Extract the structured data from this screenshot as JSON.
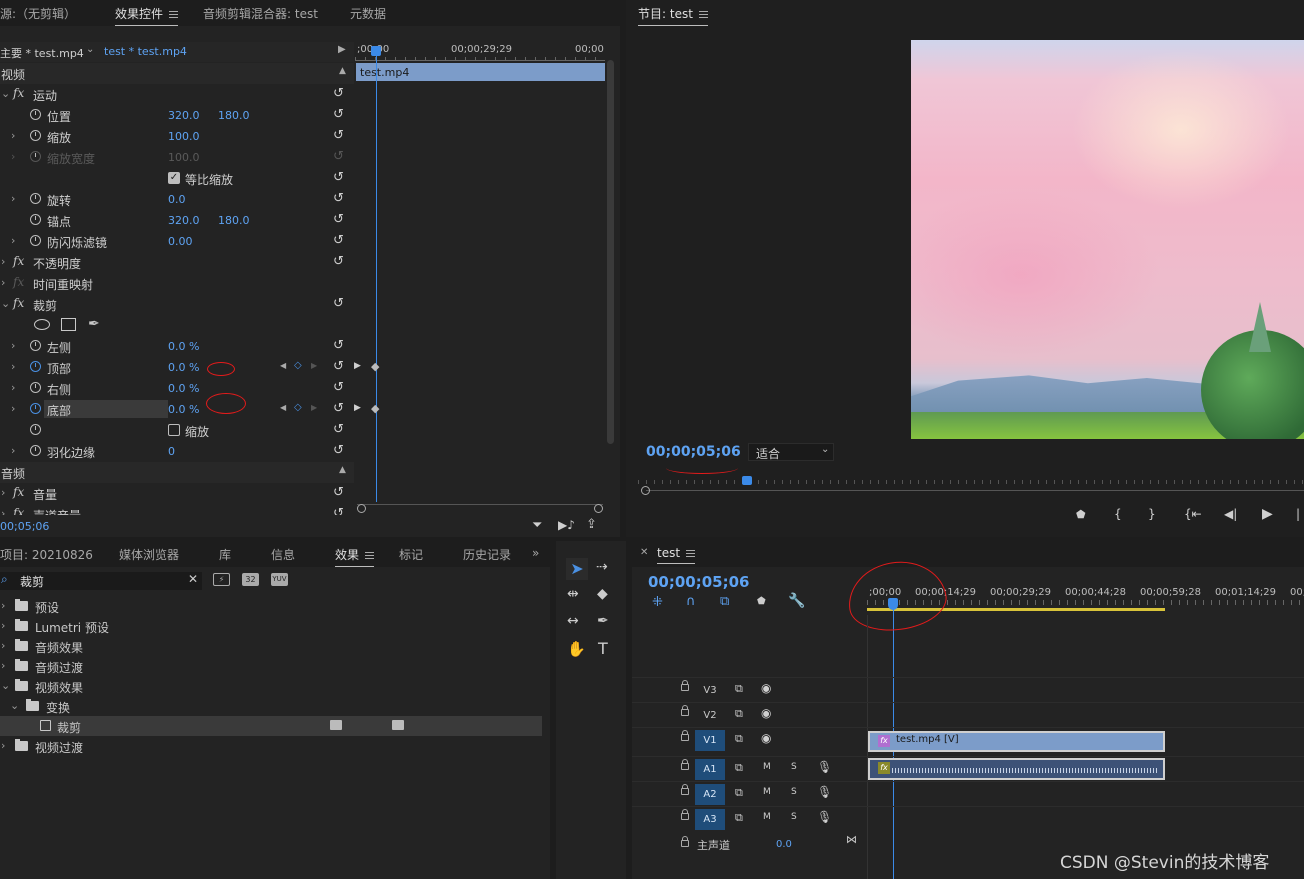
{
  "effect_controls": {
    "tabs": [
      "源:（无剪辑）",
      "效果控件",
      "音频剪辑混合器: test",
      "元数据"
    ],
    "clip_breadcrumb": {
      "master": "主要 * test.mp4",
      "clip": "test * test.mp4"
    },
    "ruler": {
      "start": ";00;00",
      "mid": "00;00;29;29",
      "end": "00;00"
    },
    "clip_bar": "test.mp4",
    "sections": {
      "video": "视频",
      "audio": "音频"
    },
    "motion": "运动",
    "position": {
      "label": "位置",
      "x": "320.0",
      "y": "180.0"
    },
    "scale": {
      "label": "缩放",
      "value": "100.0"
    },
    "scale_width": {
      "label": "缩放宽度",
      "value": "100.0"
    },
    "uniform_scale": "等比缩放",
    "rotation": {
      "label": "旋转",
      "value": "0.0"
    },
    "anchor": {
      "label": "锚点",
      "x": "320.0",
      "y": "180.0"
    },
    "anti_flicker": {
      "label": "防闪烁滤镜",
      "value": "0.00"
    },
    "opacity": "不透明度",
    "time_remap": "时间重映射",
    "crop": "裁剪",
    "crop_left": {
      "label": "左侧",
      "value": "0.0 %"
    },
    "crop_top": {
      "label": "顶部",
      "value": "0.0 %"
    },
    "crop_right": {
      "label": "右侧",
      "value": "0.0 %"
    },
    "crop_bottom": {
      "label": "底部",
      "value": "0.0 %"
    },
    "zoom": "缩放",
    "feather": {
      "label": "羽化边缘",
      "value": "0"
    },
    "volume": "音量",
    "channel_volume": "声道音量",
    "timecode": "00;05;06"
  },
  "project": {
    "tabs": [
      "项目: 20210826",
      "媒体浏览器",
      "库",
      "信息",
      "效果",
      "标记",
      "历史记录"
    ],
    "search_value": "裁剪",
    "tree": [
      "预设",
      "Lumetri 预设",
      "音频效果",
      "音频过渡",
      "视频效果",
      "变换",
      "裁剪",
      "视频过渡"
    ]
  },
  "program": {
    "title": "节目: test",
    "timecode": "00;00;05;06",
    "fit": "适合"
  },
  "timeline": {
    "title": "test",
    "timecode": "00;00;05;06",
    "ruler": [
      ";00;00",
      "00;00;14;29",
      "00;00;29;29",
      "00;00;44;28",
      "00;00;59;28",
      "00;01;14;29",
      "00;0"
    ],
    "tracks": [
      {
        "name": "V3",
        "type": "video"
      },
      {
        "name": "V2",
        "type": "video"
      },
      {
        "name": "V1",
        "type": "video"
      },
      {
        "name": "A1",
        "type": "audio"
      },
      {
        "name": "A2",
        "type": "audio"
      },
      {
        "name": "A3",
        "type": "audio"
      }
    ],
    "video_clip": "test.mp4 [V]",
    "master": {
      "label": "主声道",
      "value": "0.0"
    },
    "mute": "M",
    "solo": "S"
  },
  "watermark": "CSDN @Stevin的技术博客",
  "colors": {
    "accent": "#5ea3f3",
    "clip_video": "#7c9cc9",
    "clip_audio": "#3d5277",
    "annotation": "#e31b1b"
  }
}
